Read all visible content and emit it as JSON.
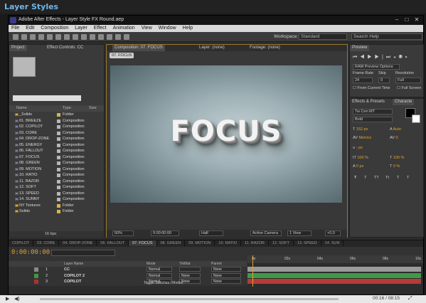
{
  "header": {
    "title": "Layer Styles"
  },
  "window": {
    "title": "Adobe After Effects - Layer Style FX Round.aep",
    "controls": [
      "–",
      "□",
      "✕"
    ]
  },
  "menu": [
    "File",
    "Edit",
    "Composition",
    "Layer",
    "Effect",
    "Animation",
    "View",
    "Window",
    "Help"
  ],
  "toolbar": {
    "workspace_label": "Workspace:",
    "workspace_value": "Standard",
    "search_placeholder": "Search Help"
  },
  "project": {
    "tabs": [
      "Project",
      "Effect Controls: CC"
    ],
    "columns": [
      "Name",
      "Type",
      "Size"
    ],
    "items": [
      {
        "name": "_Solids",
        "type": "Folder",
        "kind": "folder",
        "color": "#d6b34c"
      },
      {
        "name": "01. BREEZE",
        "type": "Composition",
        "kind": "comp",
        "color": "#b6b6b6"
      },
      {
        "name": "02. COPILOT",
        "type": "Composition",
        "kind": "comp",
        "color": "#b6b6b6"
      },
      {
        "name": "03. CORE",
        "type": "Composition",
        "kind": "comp",
        "color": "#b6b6b6"
      },
      {
        "name": "04. DROP-ZONE",
        "type": "Composition",
        "kind": "comp",
        "color": "#b6b6b6"
      },
      {
        "name": "05. ENERGY",
        "type": "Composition",
        "kind": "comp",
        "color": "#b6b6b6"
      },
      {
        "name": "06. FALLOUT",
        "type": "Composition",
        "kind": "comp",
        "color": "#b6b6b6"
      },
      {
        "name": "07. FOCUS",
        "type": "Composition",
        "kind": "comp",
        "color": "#b6b6b6"
      },
      {
        "name": "08. GREEN",
        "type": "Composition",
        "kind": "comp",
        "color": "#b6b6b6"
      },
      {
        "name": "09. MOTION",
        "type": "Composition",
        "kind": "comp",
        "color": "#b6b6b6"
      },
      {
        "name": "10. RATIO",
        "type": "Composition",
        "kind": "comp",
        "color": "#b6b6b6"
      },
      {
        "name": "11. RAZOR",
        "type": "Composition",
        "kind": "comp",
        "color": "#b6b6b6"
      },
      {
        "name": "12. SOFT",
        "type": "Composition",
        "kind": "comp",
        "color": "#b6b6b6"
      },
      {
        "name": "13. SPEED",
        "type": "Composition",
        "kind": "comp",
        "color": "#b6b6b6"
      },
      {
        "name": "14. SUNNY",
        "type": "Composition",
        "kind": "comp",
        "color": "#b6b6b6"
      },
      {
        "name": "NY Textures",
        "type": "Folder",
        "kind": "folder",
        "color": "#d6b34c"
      },
      {
        "name": "Solids",
        "type": "Folder",
        "kind": "folder",
        "color": "#d6b34c"
      }
    ],
    "footer_bpc": "16 bpc"
  },
  "composition": {
    "tabs": [
      "Composition: 07. FOCUS",
      "Layer: (none)",
      "Footage: (none)"
    ],
    "breadcrumb": "07. FOCUS",
    "viewer_text": "FOCUS",
    "footer": {
      "zoom": "50%",
      "timecode": "0:00:00:00",
      "resolution": "Half",
      "camera": "Active Camera",
      "views": "1 View",
      "offset": "+0.0"
    }
  },
  "preview": {
    "tab": "Preview",
    "ram_options": "RAM Preview Options",
    "labels": {
      "frame_rate": "Frame Rate",
      "skip": "Skip",
      "resolution": "Resolution"
    },
    "values": {
      "frame_rate": "24",
      "skip": "0",
      "resolution": "Full"
    },
    "checkboxes": [
      "From Current Time",
      "Full Screen"
    ]
  },
  "character": {
    "tabs": [
      "Effects & Presets",
      "Characte"
    ],
    "font": "Tw Cen MT",
    "style": "Bold",
    "size": "152 px",
    "leading": "Auto",
    "kerning": "Metrics",
    "tracking": "0",
    "stroke": "- px",
    "v_scale": "100 %",
    "h_scale": "100 %",
    "baseline": "0 px",
    "tsume": "0 %",
    "glyph_buttons": [
      "T",
      "T",
      "TT",
      "Tt",
      "T",
      "T"
    ],
    "fill_color": "#000000",
    "stroke_color": "#ffffff"
  },
  "timeline": {
    "tabs": [
      "COPILOT",
      "03. CORE",
      "04. DROP-ZONE",
      "06. FALLOUT",
      "07. FOCUS",
      "08. GREEN",
      "09. MOTION",
      "10. RATIO",
      "11. RAZOR",
      "12. SOFT",
      "13. SPEED",
      "14. SUN"
    ],
    "active_tab": 4,
    "current_time": "0:00:00:00",
    "columns": [
      "Layer Name",
      "Mode",
      "TrkMat",
      "Parent"
    ],
    "layers": [
      {
        "num": "1",
        "name": "CC",
        "mode": "Normal",
        "trkmat": "",
        "parent": "None",
        "color": "#8a8a8a",
        "bar": "#9a9a9a"
      },
      {
        "num": "2",
        "name": "COPILOT 2",
        "mode": "Normal",
        "trkmat": "None",
        "parent": "None",
        "color": "#3c9a3c",
        "bar": "#3f9a48"
      },
      {
        "num": "3",
        "name": "COPILOT",
        "mode": "Normal",
        "trkmat": "None",
        "parent": "None",
        "color": "#b03030",
        "bar": "#b63a3a"
      }
    ],
    "ruler_ticks": [
      "0s",
      "02s",
      "04s",
      "06s",
      "08s",
      "10s"
    ],
    "footer_label": "Toggle Switches / Modes",
    "playhead_position": 0.03
  },
  "player": {
    "timecode": "00:16 / 08:15"
  }
}
